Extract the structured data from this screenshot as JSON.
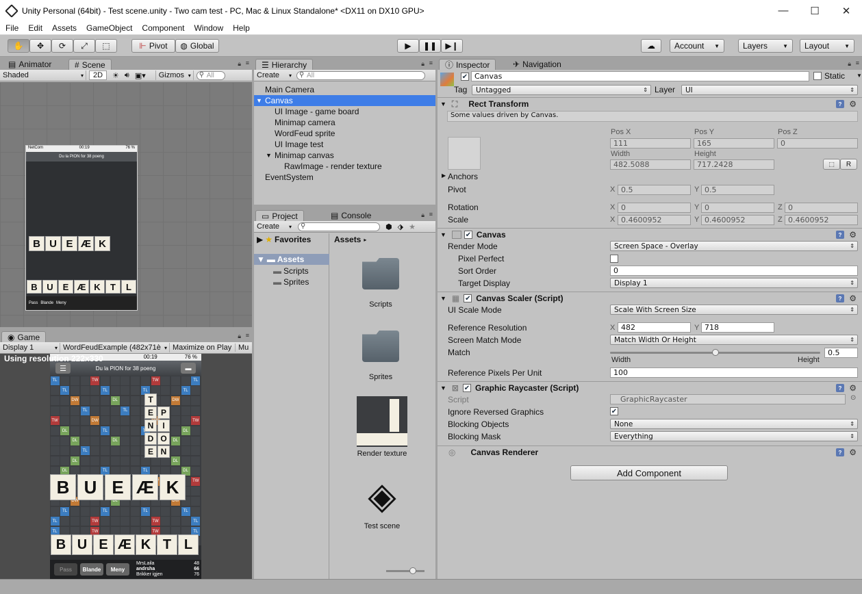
{
  "window": {
    "title": "Unity Personal (64bit) - Test scene.unity - Two cam test - PC, Mac & Linux Standalone* <DX11 on DX10 GPU>"
  },
  "menu": [
    "File",
    "Edit",
    "Assets",
    "GameObject",
    "Component",
    "Window",
    "Help"
  ],
  "toolbar": {
    "pivot": "Pivot",
    "global": "Global",
    "account": "Account",
    "layers": "Layers",
    "layout": "Layout"
  },
  "scene_panel": {
    "tabs": [
      "Animator",
      "Scene"
    ],
    "shading": "Shaded",
    "mode2d": "2D",
    "gizmos": "Gizmos",
    "search_placeholder": "All"
  },
  "game_panel": {
    "tab": "Game",
    "display": "Display 1",
    "resolution": "WordFeudExample (482x71è",
    "maximize": "Maximize on Play",
    "mute": "Mu",
    "overlay": "Using resolution 222x330"
  },
  "phone": {
    "carrier": "NetCom",
    "time": "00:19",
    "battery": "76 %",
    "header": "Du la PION for 38 poeng",
    "tray": [
      "B",
      "U",
      "E",
      "Æ",
      "K",
      "T",
      "L"
    ],
    "tray_scores": [
      "4",
      "4",
      "1",
      "8",
      "3",
      "1",
      "2"
    ],
    "played": [
      "B",
      "U",
      "E",
      "Æ",
      "K"
    ],
    "played_scores": [
      "4",
      "4",
      "1",
      "8"
    ],
    "word": [
      "T",
      "E",
      "N",
      "D",
      "E"
    ],
    "word2": [
      "P",
      "I",
      "O",
      "N"
    ],
    "buttons": [
      "Pass",
      "Blande",
      "Meny"
    ],
    "players": [
      {
        "name": "MrsLaila",
        "score": "48"
      },
      {
        "name": "andrsha",
        "score": "66"
      },
      {
        "name": "Brikker igjen",
        "score": "76"
      }
    ]
  },
  "hierarchy": {
    "tab": "Hierarchy",
    "create": "Create",
    "search_placeholder": "All",
    "items": [
      {
        "label": "Main Camera",
        "indent": 0
      },
      {
        "label": "Canvas",
        "indent": 0,
        "selected": true,
        "arrow": "▼"
      },
      {
        "label": "UI Image - game board",
        "indent": 1
      },
      {
        "label": "Minimap camera",
        "indent": 1
      },
      {
        "label": "WordFeud sprite",
        "indent": 1
      },
      {
        "label": "UI Image test",
        "indent": 1
      },
      {
        "label": "Minimap canvas",
        "indent": 1,
        "arrow": "▼"
      },
      {
        "label": "RawImage - render texture",
        "indent": 2
      },
      {
        "label": "EventSystem",
        "indent": 0
      }
    ]
  },
  "project": {
    "tabs": [
      "Project",
      "Console"
    ],
    "create": "Create",
    "favorites": "Favorites",
    "assets_root": "Assets",
    "folders": [
      "Scripts",
      "Sprites"
    ],
    "breadcrumb": "Assets",
    "items": [
      "Scripts",
      "Sprites",
      "Render texture",
      "Test scene"
    ]
  },
  "inspector": {
    "tabs": [
      "Inspector",
      "Navigation"
    ],
    "object_name": "Canvas",
    "static_label": "Static",
    "tag_label": "Tag",
    "tag": "Untagged",
    "layer_label": "Layer",
    "layer": "UI",
    "rect": {
      "title": "Rect Transform",
      "note": "Some values driven by Canvas.",
      "posx_label": "Pos X",
      "posy_label": "Pos Y",
      "posz_label": "Pos Z",
      "posx": "111",
      "posy": "165",
      "posz": "0",
      "width_label": "Width",
      "height_label": "Height",
      "width": "482.5088",
      "height": "717.2428",
      "anchors": "Anchors",
      "pivot": "Pivot",
      "pivot_x": "0.5",
      "pivot_y": "0.5",
      "rotation": "Rotation",
      "rot_x": "0",
      "rot_y": "0",
      "rot_z": "0",
      "scale": "Scale",
      "scale_x": "0.4600952",
      "scale_y": "0.4600952",
      "scale_z": "0.4600952",
      "btn_r": "R"
    },
    "canvas": {
      "title": "Canvas",
      "render_mode_label": "Render Mode",
      "render_mode": "Screen Space - Overlay",
      "pixel_perfect": "Pixel Perfect",
      "sort_order_label": "Sort Order",
      "sort_order": "0",
      "target_display_label": "Target Display",
      "target_display": "Display 1"
    },
    "scaler": {
      "title": "Canvas Scaler (Script)",
      "scale_mode_label": "UI Scale Mode",
      "scale_mode": "Scale With Screen Size",
      "ref_res_label": "Reference Resolution",
      "ref_x": "482",
      "ref_y": "718",
      "match_mode_label": "Screen Match Mode",
      "match_mode": "Match Width Or Height",
      "match_label": "Match",
      "match": "0.5",
      "width_lbl": "Width",
      "height_lbl": "Height",
      "ppu_label": "Reference Pixels Per Unit",
      "ppu": "100"
    },
    "raycaster": {
      "title": "Graphic Raycaster (Script)",
      "script_label": "Script",
      "script": "GraphicRaycaster",
      "ignore_label": "Ignore Reversed Graphics",
      "blocking_objects_label": "Blocking Objects",
      "blocking_objects": "None",
      "blocking_mask_label": "Blocking Mask",
      "blocking_mask": "Everything"
    },
    "renderer": {
      "title": "Canvas Renderer"
    },
    "add_component": "Add Component"
  },
  "axes": {
    "x": "X",
    "y": "Y",
    "z": "Z"
  },
  "colors": {
    "selection": "#3e7de7",
    "panel": "#c2c2c2",
    "board": "#3b3d40",
    "tl": "#3c7dc0",
    "dl": "#78a45c",
    "dw": "#c27a36",
    "tw": "#b23b3b"
  }
}
